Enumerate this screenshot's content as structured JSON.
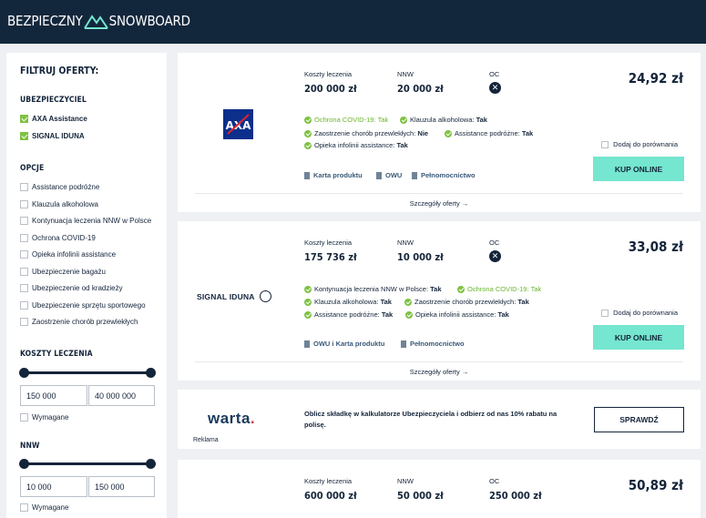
{
  "header": {
    "logo_left": "BEZPIECZNY",
    "logo_right": "SNOWBOARD"
  },
  "sidebar": {
    "title": "FILTRUJ OFERTY:",
    "insurer_heading": "UBEZPIECZYCIEL",
    "insurers": [
      {
        "label": "AXA Assistance",
        "checked": true
      },
      {
        "label": "SIGNAL IDUNA",
        "checked": true
      }
    ],
    "options_heading": "OPCJE",
    "options": [
      "Assistance podróżne",
      "Klauzula alkoholowa",
      "Kontynuacja leczenia NNW w Polsce",
      "Ochrona COVID-19",
      "Opieka infolinii assistance",
      "Ubezpieczenie bagażu",
      "Ubezpieczenie od kradzieży",
      "Ubezpieczenie sprzętu sportowego",
      "Zaostrzenie chorób przewlekłych"
    ],
    "cost_heading": "KOSZTY LECZENIA",
    "cost_min": "150 000",
    "cost_max": "40 000 000",
    "cost_required": "Wymagane",
    "nnw_heading": "NNW",
    "nnw_min": "10 000",
    "nnw_max": "150 000",
    "nnw_required": "Wymagane"
  },
  "labels": {
    "cost": "Koszty leczenia",
    "nnw": "NNW",
    "oc": "OC",
    "compare": "Dodaj do porównania",
    "buy": "KUP ONLINE",
    "details": "Szczegóły oferty →",
    "x_icon": "✕"
  },
  "offers": [
    {
      "insurer": "AXA",
      "cost": "200 000 zł",
      "nnw": "20 000 zł",
      "price": "24,92 zł",
      "features": [
        {
          "name": "Ochrona COVID-19:",
          "value": "Tak",
          "green": true
        },
        {
          "name": "Klauzula alkoholowa:",
          "value": "Tak"
        },
        {
          "name": "Zaostrzenie chorób przewlekłych:",
          "value": "Nie"
        },
        {
          "name": "Assistance podróżne:",
          "value": "Tak"
        },
        {
          "name": "Opieka infolinii assistance:",
          "value": "Tak"
        }
      ],
      "docs": [
        "Karta produktu",
        "OWU",
        "Pełnomocnictwo"
      ]
    },
    {
      "insurer": "SIGNAL IDUNA",
      "cost": "175 736 zł",
      "nnw": "10 000 zł",
      "price": "33,08 zł",
      "features": [
        {
          "name": "Kontynuacja leczenia NNW w Polsce:",
          "value": "Tak"
        },
        {
          "name": "Ochrona COVID-19:",
          "value": "Tak",
          "green": true
        },
        {
          "name": "Klauzula alkoholowa:",
          "value": "Tak"
        },
        {
          "name": "Zaostrzenie chorób przewlekłych:",
          "value": "Tak"
        },
        {
          "name": "Assistance podróżne:",
          "value": "Tak"
        },
        {
          "name": "Opieka infolinii assistance:",
          "value": "Tak"
        }
      ],
      "docs": [
        "OWU i Karta produktu",
        "Pełnomocnictwo"
      ]
    },
    {
      "insurer": "",
      "cost": "600 000 zł",
      "nnw": "50 000 zł",
      "oc": "250 000 zł",
      "price": "50,89 zł"
    }
  ],
  "ad": {
    "brand": "warta",
    "brand_dot": ".",
    "tag": "Reklama",
    "text": "Oblicz składkę w kalkulatorze Ubezpieczyciela i odbierz od nas 10% rabatu na polisę.",
    "button": "SPRAWDŹ"
  }
}
